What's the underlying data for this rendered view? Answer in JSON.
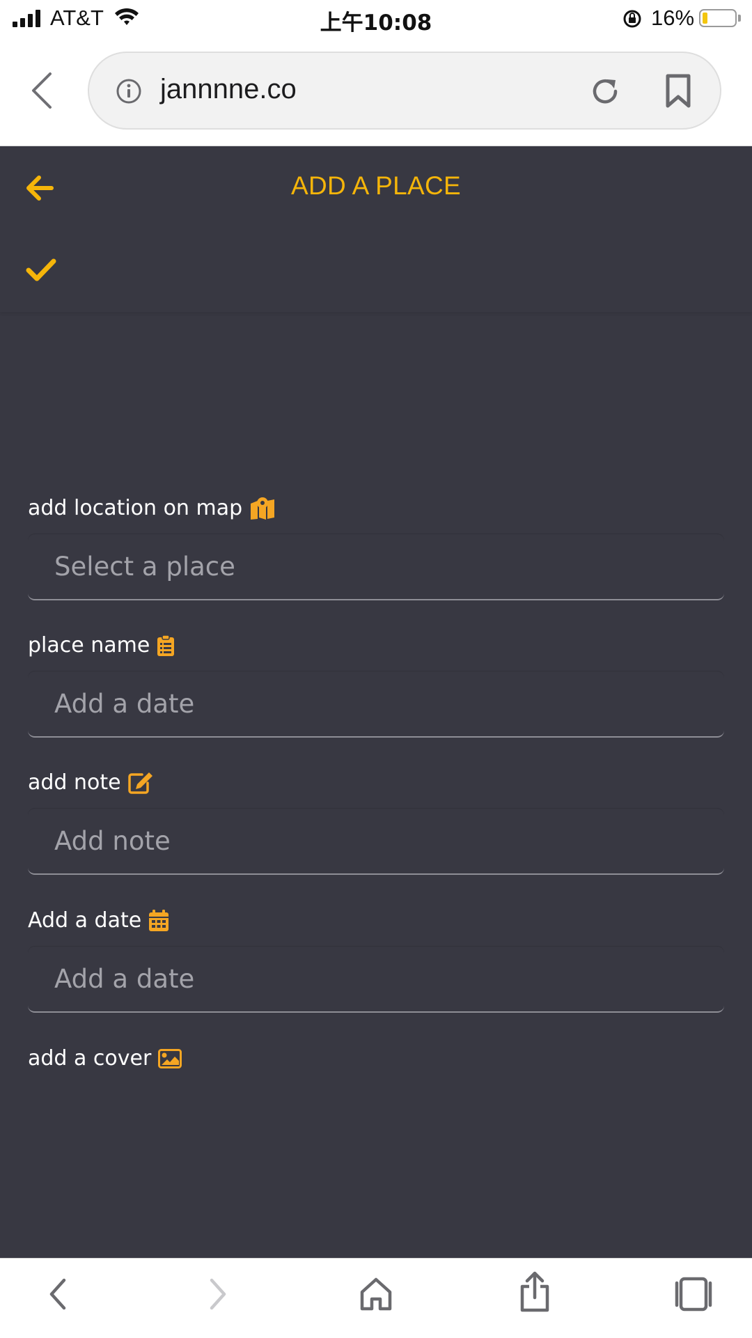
{
  "status_bar": {
    "carrier": "AT&T",
    "time": "上午10:08",
    "battery_percent": "16%",
    "battery_level": 0.16,
    "battery_color": "#f3c610"
  },
  "browser": {
    "url": "jannnne.co",
    "icons": [
      "chevron-left-icon",
      "info-icon",
      "reload-icon",
      "bookmark-icon"
    ]
  },
  "header": {
    "title": "ADD A PLACE",
    "accent_color": "#f5b50a",
    "icons": [
      "arrow-left-icon",
      "check-icon"
    ]
  },
  "form": {
    "location": {
      "label": "add location on map",
      "placeholder": "Select a place",
      "icon": "map-marker-icon"
    },
    "place_name": {
      "label": "place name",
      "placeholder": "Add a date",
      "icon": "clipboard-icon"
    },
    "note": {
      "label": "add note",
      "placeholder": "Add note",
      "icon": "edit-icon"
    },
    "date": {
      "label": "Add a date",
      "placeholder": "Add a date",
      "icon": "calendar-icon"
    },
    "cover": {
      "label": "add a cover",
      "icon": "image-icon"
    }
  },
  "toolbar": {
    "icons": [
      "back-icon",
      "forward-icon",
      "home-icon",
      "share-icon",
      "tabs-icon"
    ]
  },
  "colors": {
    "background": "#383842",
    "accent": "#f5b50a",
    "icon_orange": "#f5a623"
  }
}
